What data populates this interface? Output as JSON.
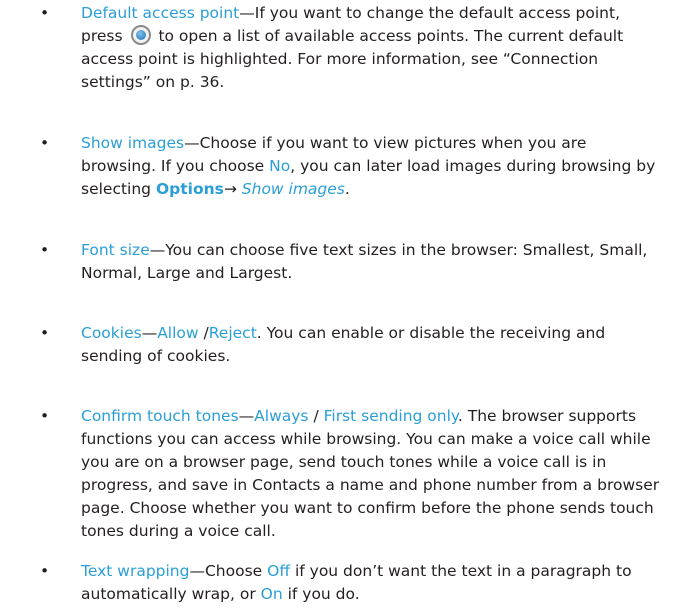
{
  "bullet": "•",
  "items": [
    {
      "term": "Default access point",
      "dash": "—",
      "t1": "If you want to change the default access point, press",
      "icon": "navigation-key-icon",
      "t2": "to open a list of available access points. The current default access point is highlighted. For more information, see “Connection settings” on p. 36."
    },
    {
      "term": "Show images",
      "dash": "—",
      "t1": "Choose if you want to view pictures when you are browsing. If you choose ",
      "no": "No",
      "t2": ", you can later load images during browsing by selecting ",
      "options": "Options",
      "arrow": "→ ",
      "show": "Show images",
      "t3": "."
    },
    {
      "term": "Font size",
      "dash": "—",
      "t1": "You can choose five text sizes in the browser: Smallest, Small, Normal, Large and Largest."
    },
    {
      "term": "Cookies",
      "dash": "—",
      "allow": "Allow",
      "sep": " /",
      "reject": "Reject",
      "t1": ". You can enable or disable the receiving and sending of cookies."
    },
    {
      "term": "Confirm touch tones",
      "dash": "—",
      "always": "Always",
      "sep": " / ",
      "first": "First sending only",
      "t1": ". The browser supports functions you can access while browsing. You can make a voice call while you are on a browser page, send touch tones while a voice call is in progress, and save in Contacts a name and phone number from a browser page. Choose whether you want to confirm before the phone sends touch tones during a voice call."
    },
    {
      "term": "Text wrapping",
      "dash": "—",
      "t1": "Choose ",
      "off": "Off",
      "t2": " if you don’t want the text in a paragraph to automatically wrap, or ",
      "on": "On",
      "t3": " if you do."
    }
  ],
  "colors": {
    "link": "#2a9fd6",
    "text": "#231f20"
  }
}
